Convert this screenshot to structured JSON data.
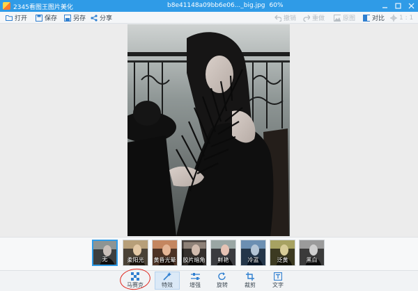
{
  "window": {
    "app_title": "2345看图王图片美化",
    "file_name": "b8e41148a09bb6e06..._big.jpg",
    "zoom": "60%",
    "controls": [
      "min",
      "max",
      "close"
    ],
    "accent_color": "#2f9be7"
  },
  "toolbar": {
    "left": [
      {
        "id": "open",
        "label": "打开",
        "icon": "folder-icon"
      },
      {
        "id": "save",
        "label": "保存",
        "icon": "save-icon"
      },
      {
        "id": "save_as",
        "label": "另存",
        "icon": "save-as-icon"
      },
      {
        "id": "share",
        "label": "分享",
        "icon": "share-icon"
      }
    ],
    "right": [
      {
        "id": "undo",
        "label": "撤销",
        "icon": "undo-icon",
        "enabled": false
      },
      {
        "id": "redo",
        "label": "重做",
        "icon": "redo-icon",
        "enabled": false
      },
      {
        "id": "original",
        "label": "原图",
        "icon": "image-icon",
        "enabled": false
      },
      {
        "id": "compare",
        "label": "对比",
        "icon": "compare-icon",
        "enabled": true
      }
    ],
    "ratio": "1 : 1"
  },
  "filters": [
    {
      "label": "无",
      "selected": true
    },
    {
      "label": "柔阳光",
      "selected": false
    },
    {
      "label": "黄昏光晕",
      "selected": false
    },
    {
      "label": "胶片暗角",
      "selected": false
    },
    {
      "label": "鲜艳",
      "selected": false
    },
    {
      "label": "冷蓝",
      "selected": false
    },
    {
      "label": "泛黄",
      "selected": false
    },
    {
      "label": "黑白",
      "selected": false
    }
  ],
  "bottom_tools": [
    {
      "id": "mosaic",
      "label": "马赛克",
      "icon": "mosaic-icon",
      "active": false
    },
    {
      "id": "effects",
      "label": "特效",
      "icon": "magic-wand-icon",
      "active": true
    },
    {
      "id": "enhance",
      "label": "增强",
      "icon": "sliders-icon",
      "active": false
    },
    {
      "id": "rotate",
      "label": "旋转",
      "icon": "rotate-icon",
      "active": false
    },
    {
      "id": "crop",
      "label": "裁剪",
      "icon": "crop-icon",
      "active": false
    },
    {
      "id": "text",
      "label": "文字",
      "icon": "text-icon",
      "active": false
    }
  ]
}
